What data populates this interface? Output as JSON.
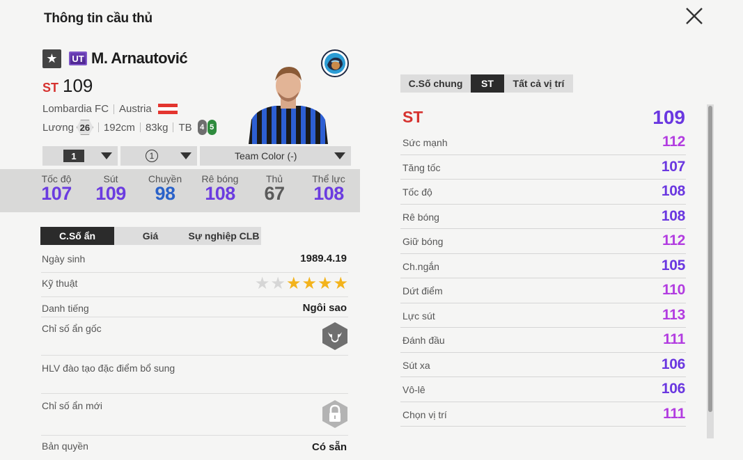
{
  "header": {
    "title": "Thông tin cầu thủ"
  },
  "player": {
    "season_badge": "UT",
    "name": "M. Arnautović",
    "position": "ST",
    "ovr": "109",
    "club": "Lombardia FC",
    "nation": "Austria",
    "salary_label": "Lương",
    "salary": "26",
    "height": "192cm",
    "weight": "83kg",
    "body_type": "TB",
    "weak_foot_left": "4",
    "weak_foot_right": "5"
  },
  "selectors": {
    "level": "1",
    "upgrade": "1",
    "team_color": "Team Color (-)"
  },
  "summary": [
    {
      "label": "Tốc độ",
      "value": "107",
      "color": "#6b3ce0"
    },
    {
      "label": "Sút",
      "value": "109",
      "color": "#6b3ce0"
    },
    {
      "label": "Chuyền",
      "value": "98",
      "color": "#2a62c9"
    },
    {
      "label": "Rê bóng",
      "value": "108",
      "color": "#6b3ce0"
    },
    {
      "label": "Thủ",
      "value": "67",
      "color": "#5a5a5a"
    },
    {
      "label": "Thể lực",
      "value": "108",
      "color": "#6b3ce0"
    }
  ],
  "left_tabs": [
    {
      "label": "C.Số ẩn",
      "active": true
    },
    {
      "label": "Giá",
      "active": false
    },
    {
      "label": "Sự nghiệp CLB",
      "active": false
    }
  ],
  "details": {
    "birth_label": "Ngày sinh",
    "birth_value": "1989.4.19",
    "skill_label": "Kỹ thuật",
    "skill_stars": 4,
    "skill_max": 6,
    "fame_label": "Danh tiếng",
    "fame_value": "Ngôi sao",
    "base_trait_label": "Chỉ số ẩn gốc",
    "coach_label": "HLV đào tạo đặc điểm bổ sung",
    "new_trait_label": "Chỉ số ẩn mới",
    "license_label": "Bản quyền",
    "license_value": "Có sẵn"
  },
  "right_tabs": [
    {
      "label": "C.Số chung",
      "active": false
    },
    {
      "label": "ST",
      "active": true
    },
    {
      "label": "Tất cả vị trí",
      "active": false
    }
  ],
  "attributes_header": {
    "label": "ST",
    "value": "109"
  },
  "attributes": [
    {
      "label": "Sức mạnh",
      "value": "112",
      "color": "#b23ce0"
    },
    {
      "label": "Tăng tốc",
      "value": "107",
      "color": "#6a37e0"
    },
    {
      "label": "Tốc độ",
      "value": "108",
      "color": "#6a37e0"
    },
    {
      "label": "Rê bóng",
      "value": "108",
      "color": "#6a37e0"
    },
    {
      "label": "Giữ bóng",
      "value": "112",
      "color": "#b23ce0"
    },
    {
      "label": "Ch.ngắn",
      "value": "105",
      "color": "#6a37e0"
    },
    {
      "label": "Dứt điểm",
      "value": "110",
      "color": "#b23ce0"
    },
    {
      "label": "Lực sút",
      "value": "113",
      "color": "#b23ce0"
    },
    {
      "label": "Đánh đầu",
      "value": "111",
      "color": "#b23ce0"
    },
    {
      "label": "Sút xa",
      "value": "106",
      "color": "#6a37e0"
    },
    {
      "label": "Vô-lê",
      "value": "106",
      "color": "#6a37e0"
    },
    {
      "label": "Chọn vị trí",
      "value": "111",
      "color": "#b23ce0"
    }
  ]
}
